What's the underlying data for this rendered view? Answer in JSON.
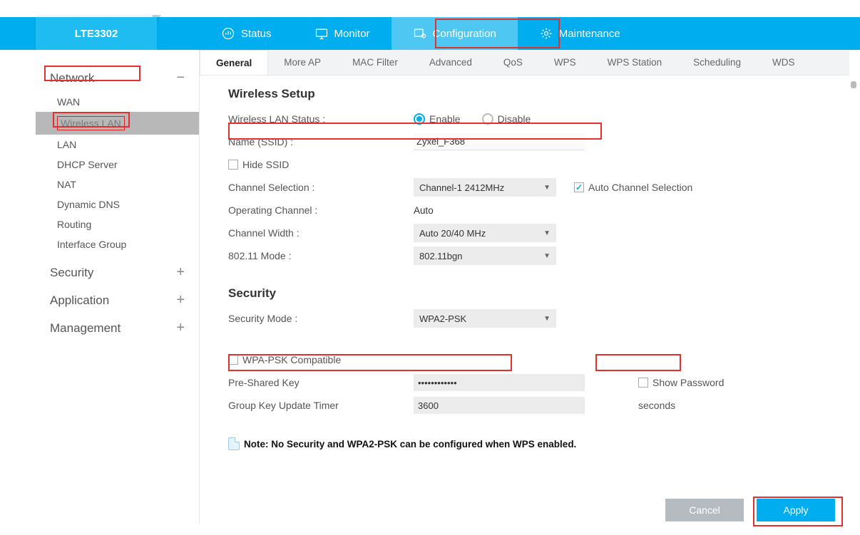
{
  "device": "LTE3302",
  "mainnav": {
    "status": "Status",
    "monitor": "Monitor",
    "configuration": "Configuration",
    "maintenance": "Maintenance"
  },
  "sidebar": {
    "sections": {
      "network": {
        "label": "Network",
        "expanded": true,
        "items": [
          "WAN",
          "Wireless LAN",
          "LAN",
          "DHCP Server",
          "NAT",
          "Dynamic DNS",
          "Routing",
          "Interface Group"
        ],
        "active_index": 1
      },
      "security": {
        "label": "Security",
        "expanded": false
      },
      "application": {
        "label": "Application",
        "expanded": false
      },
      "management": {
        "label": "Management",
        "expanded": false
      }
    }
  },
  "subtabs": [
    "General",
    "More AP",
    "MAC Filter",
    "Advanced",
    "QoS",
    "WPS",
    "WPS Station",
    "Scheduling",
    "WDS"
  ],
  "subtab_active_index": 0,
  "wireless": {
    "heading": "Wireless Setup",
    "status_label": "Wireless LAN Status :",
    "status_enable": "Enable",
    "status_disable": "Disable",
    "status_value": "Enable",
    "ssid_label": "Name (SSID) :",
    "ssid_value": "Zyxel_F368",
    "hide_ssid_label": "Hide SSID",
    "hide_ssid_checked": false,
    "channel_sel_label": "Channel Selection :",
    "channel_sel_value": "Channel-1 2412MHz",
    "auto_channel_label": "Auto Channel Selection",
    "auto_channel_checked": true,
    "oper_channel_label": "Operating Channel :",
    "oper_channel_value": "Auto",
    "channel_width_label": "Channel Width :",
    "channel_width_value": "Auto 20/40 MHz",
    "mode_label": "802.11 Mode :",
    "mode_value": "802.11bgn"
  },
  "security": {
    "heading": "Security",
    "sec_mode_label": "Security Mode :",
    "sec_mode_value": "WPA2-PSK",
    "wpa_compat_label": "WPA-PSK Compatible",
    "wpa_compat_checked": false,
    "psk_label": "Pre-Shared Key",
    "psk_value": "••••••••••••",
    "show_pw_label": "Show Password",
    "show_pw_checked": false,
    "gkut_label": "Group Key Update Timer",
    "gkut_value": "3600",
    "gkut_unit": "seconds"
  },
  "note": "Note: No Security and WPA2-PSK can be configured when WPS enabled.",
  "buttons": {
    "cancel": "Cancel",
    "apply": "Apply"
  }
}
